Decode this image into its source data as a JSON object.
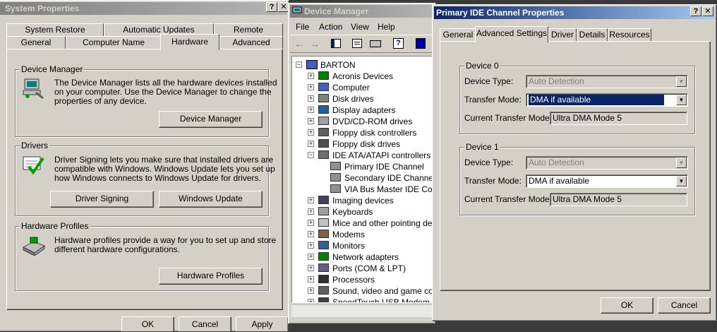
{
  "system_properties": {
    "title": "System Properties",
    "tabs_back": [
      "System Restore",
      "Automatic Updates",
      "Remote"
    ],
    "tabs_front": [
      "General",
      "Computer Name",
      "Hardware",
      "Advanced"
    ],
    "device_manager": {
      "group": "Device Manager",
      "desc": [
        "The Device Manager lists all the hardware devices installed",
        "on your computer. Use the Device Manager to change the",
        "properties of any device."
      ],
      "button": "Device Manager"
    },
    "drivers": {
      "group": "Drivers",
      "desc": [
        "Driver Signing lets you make sure that installed drivers are",
        "compatible with Windows. Windows Update lets you set up",
        "how Windows connects to Windows Update for drivers."
      ],
      "signing_button": "Driver Signing",
      "update_button": "Windows Update"
    },
    "hardware_profiles": {
      "group": "Hardware Profiles",
      "desc": [
        "Hardware profiles provide a way for you to set up and store",
        "different hardware configurations."
      ],
      "button": "Hardware Profiles"
    },
    "bottom_buttons": [
      "OK",
      "Cancel",
      "Apply"
    ]
  },
  "device_manager": {
    "title": "Device Manager",
    "menu": [
      "File",
      "Action",
      "View",
      "Help"
    ],
    "root": "BARTON",
    "items": [
      {
        "label": "Acronis Devices",
        "expander": "+",
        "icon": "acronis-icon",
        "level": 1
      },
      {
        "label": "Computer",
        "expander": "+",
        "icon": "computer-icon",
        "level": 1
      },
      {
        "label": "Disk drives",
        "expander": "+",
        "icon": "disk-drive-icon",
        "level": 1
      },
      {
        "label": "Display adapters",
        "expander": "+",
        "icon": "display-adapter-icon",
        "level": 1
      },
      {
        "label": "DVD/CD-ROM drives",
        "expander": "+",
        "icon": "cdrom-icon",
        "level": 1
      },
      {
        "label": "Floppy disk controllers",
        "expander": "+",
        "icon": "floppy-controller-icon",
        "level": 1
      },
      {
        "label": "Floppy disk drives",
        "expander": "+",
        "icon": "floppy-drive-icon",
        "level": 1
      },
      {
        "label": "IDE ATA/ATAPI controllers",
        "expander": "-",
        "icon": "ide-controller-icon",
        "level": 1
      },
      {
        "label": "Primary IDE Channel",
        "expander": "",
        "icon": "ide-channel-icon",
        "level": 2
      },
      {
        "label": "Secondary IDE Channel",
        "expander": "",
        "icon": "ide-channel-icon",
        "level": 2
      },
      {
        "label": "VIA Bus Master IDE Controller",
        "expander": "",
        "icon": "ide-channel-icon",
        "level": 2
      },
      {
        "label": "Imaging devices",
        "expander": "+",
        "icon": "imaging-icon",
        "level": 1
      },
      {
        "label": "Keyboards",
        "expander": "+",
        "icon": "keyboard-icon",
        "level": 1
      },
      {
        "label": "Mice and other pointing devices",
        "expander": "+",
        "icon": "mouse-icon",
        "level": 1
      },
      {
        "label": "Modems",
        "expander": "+",
        "icon": "modem-icon",
        "level": 1
      },
      {
        "label": "Monitors",
        "expander": "+",
        "icon": "monitor-icon",
        "level": 1
      },
      {
        "label": "Network adapters",
        "expander": "+",
        "icon": "network-adapter-icon",
        "level": 1
      },
      {
        "label": "Ports (COM & LPT)",
        "expander": "+",
        "icon": "port-icon",
        "level": 1
      },
      {
        "label": "Processors",
        "expander": "+",
        "icon": "processor-icon",
        "level": 1
      },
      {
        "label": "Sound, video and game controllers",
        "expander": "+",
        "icon": "sound-icon",
        "level": 1
      },
      {
        "label": "SpeedTouch USB Modem",
        "expander": "+",
        "icon": "usb-modem-icon",
        "level": 1
      }
    ]
  },
  "ide_properties": {
    "title": "Primary IDE Channel Properties",
    "tabs": [
      "General",
      "Advanced Settings",
      "Driver",
      "Details",
      "Resources"
    ],
    "selected_tab": "Advanced Settings",
    "device0": {
      "group": "Device 0",
      "device_type_label": "Device Type:",
      "device_type_value": "Auto Detection",
      "transfer_mode_label": "Transfer Mode:",
      "transfer_mode_value": "DMA if available",
      "current_mode_label": "Current Transfer Mode:",
      "current_mode_value": "Ultra DMA Mode 5"
    },
    "device1": {
      "group": "Device 1",
      "device_type_label": "Device Type:",
      "device_type_value": "Auto Detection",
      "transfer_mode_label": "Transfer Mode:",
      "transfer_mode_value": "DMA if available",
      "current_mode_label": "Current Transfer Mode:",
      "current_mode_value": "Ultra DMA Mode 5"
    },
    "ok": "OK",
    "cancel": "Cancel"
  },
  "colors": {
    "face": "#d4d0c8",
    "active_title": "#0a246a",
    "selection": "#0a246a"
  }
}
